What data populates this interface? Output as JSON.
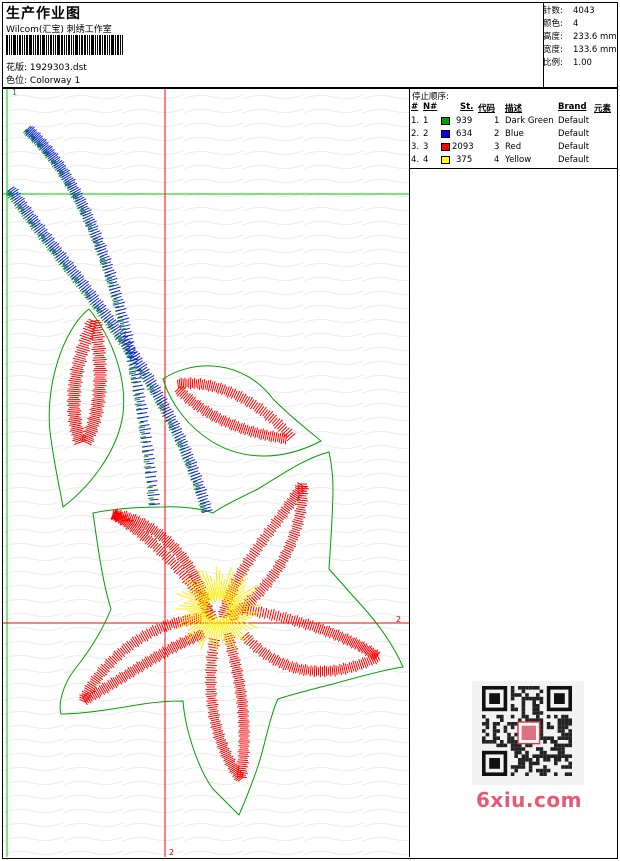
{
  "header": {
    "title": "生产作业图",
    "company": "Wilcom(汇宝) 刺绣工作室",
    "design_label": "花版:",
    "design_value": "1929303.dst",
    "colorway_label": "色位:",
    "colorway_value": "Colorway 1"
  },
  "stats": [
    {
      "label": "针数:",
      "value": "4043"
    },
    {
      "label": "颜色:",
      "value": "4"
    },
    {
      "label": "高度:",
      "value": "233.6 mm"
    },
    {
      "label": "宽度:",
      "value": "133.6 mm"
    },
    {
      "label": "比例:",
      "value": "1.00"
    }
  ],
  "stop_sequence": {
    "title": "停止顺序:",
    "columns": [
      "#",
      "N#",
      "St.",
      "代码",
      "描述",
      "Brand",
      "元素"
    ],
    "rows": [
      {
        "idx": "1.",
        "n": "1",
        "color": "#00a000",
        "st": "939",
        "code": "1",
        "desc": "Dark Green",
        "brand": "Default"
      },
      {
        "idx": "2.",
        "n": "2",
        "color": "#0000ff",
        "st": "634",
        "code": "2",
        "desc": "Blue",
        "brand": "Default"
      },
      {
        "idx": "3.",
        "n": "3",
        "color": "#ff0000",
        "st": "2093",
        "code": "3",
        "desc": "Red",
        "brand": "Default"
      },
      {
        "idx": "4.",
        "n": "4",
        "color": "#ffff00",
        "st": "375",
        "code": "4",
        "desc": "Yellow",
        "brand": "Default"
      }
    ]
  },
  "axes": {
    "green_label": "1",
    "red_label_h": "2",
    "red_label_v": "2"
  },
  "watermark": "6xiu.com",
  "colors": {
    "stitch_green": "#00a000",
    "stitch_blue": "#1020e0",
    "stitch_red": "#ff0000",
    "stitch_yellow": "#ffee00",
    "outline_green": "#00a000",
    "guide_red": "#ff0000",
    "guide_green": "#00cc00"
  }
}
